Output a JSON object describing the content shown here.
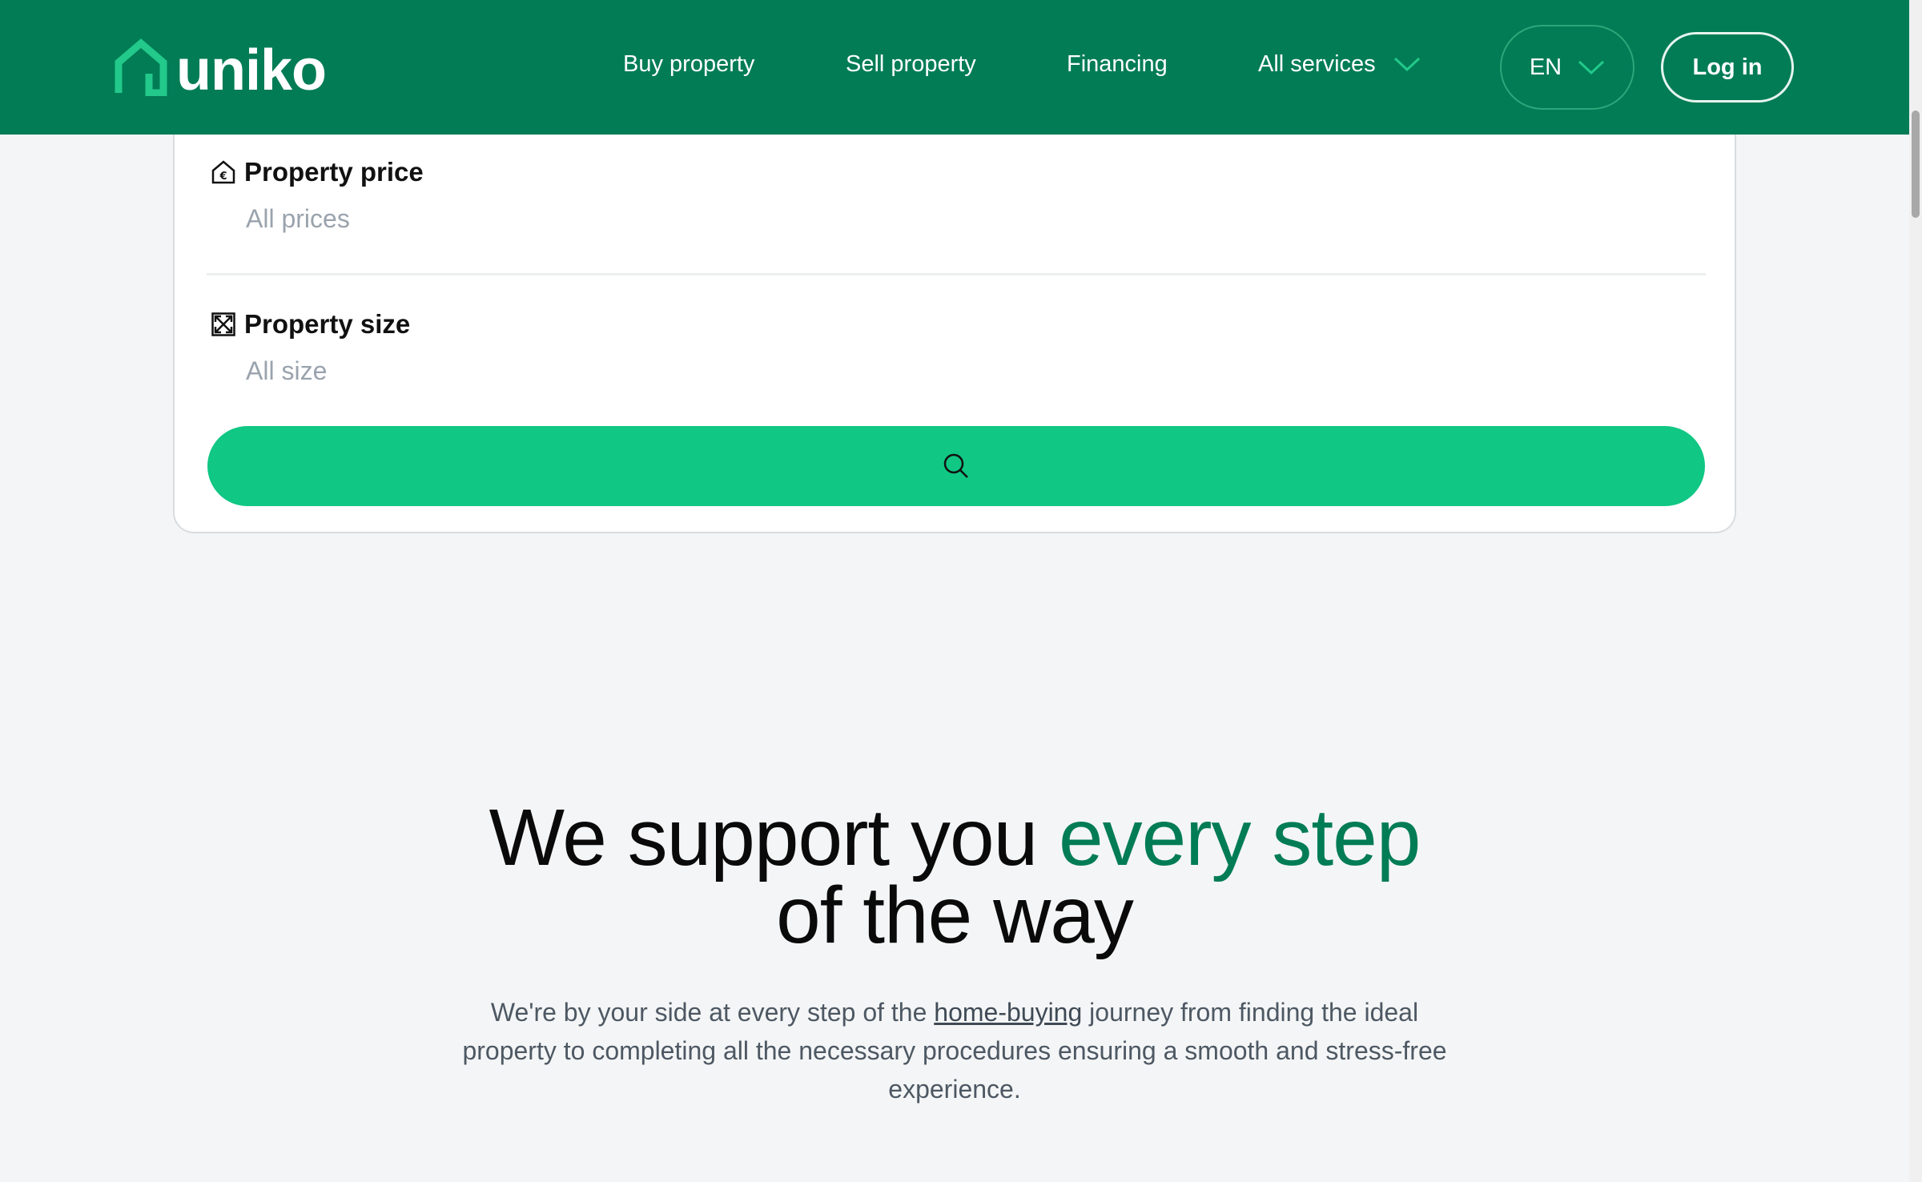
{
  "header": {
    "logo_text": "uniko",
    "nav": {
      "buy": "Buy property",
      "sell": "Sell property",
      "financing": "Financing",
      "services": "All services"
    },
    "language": "EN",
    "login": "Log in"
  },
  "search": {
    "price": {
      "label": "Property price",
      "value": "All prices"
    },
    "size": {
      "label": "Property size",
      "value": "All size"
    },
    "button_icon": "search-icon"
  },
  "hero": {
    "title_part1": "We support you ",
    "title_accent": "every step",
    "title_part2": "of the way",
    "desc_before": "We're by your side at every step of the ",
    "desc_link": "home-buying",
    "desc_after": " journey from finding the ideal property to completing all the necessary procedures ensuring a smooth and stress-free experience."
  },
  "colors": {
    "brand_green": "#017c55",
    "accent_green": "#10c784",
    "logo_green": "#22c98a"
  }
}
